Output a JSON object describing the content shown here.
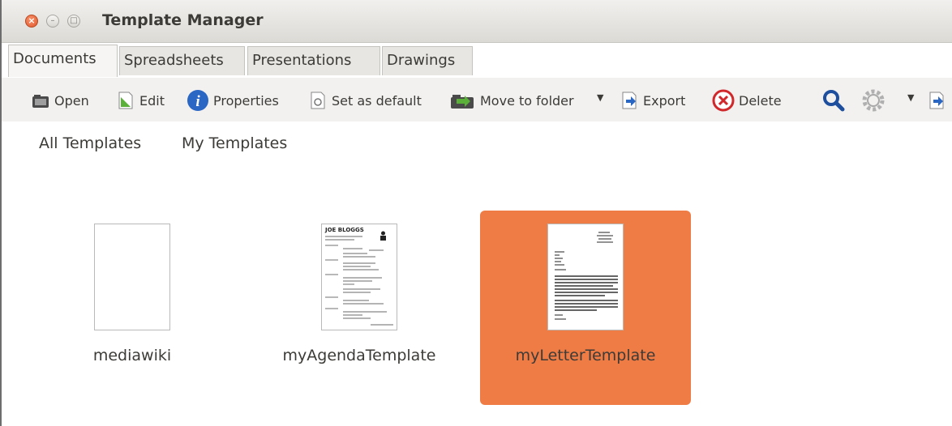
{
  "window": {
    "title": "Template Manager"
  },
  "tabs": [
    {
      "label": "Documents",
      "active": true
    },
    {
      "label": "Spreadsheets"
    },
    {
      "label": "Presentations"
    },
    {
      "label": "Drawings"
    }
  ],
  "toolbar": {
    "open": "Open",
    "edit": "Edit",
    "properties": "Properties",
    "set_default": "Set as default",
    "move_to_folder": "Move to folder",
    "export": "Export",
    "delete": "Delete"
  },
  "nav": {
    "all": "All Templates",
    "mine": "My Templates"
  },
  "templates": [
    {
      "name": "mediawiki"
    },
    {
      "name": "myAgendaTemplate",
      "heading": "JOE BLOGGS"
    },
    {
      "name": "myLetterTemplate",
      "selected": true
    }
  ],
  "colors": {
    "selection": "#ef7b45",
    "accent_blue": "#2a66c4"
  }
}
